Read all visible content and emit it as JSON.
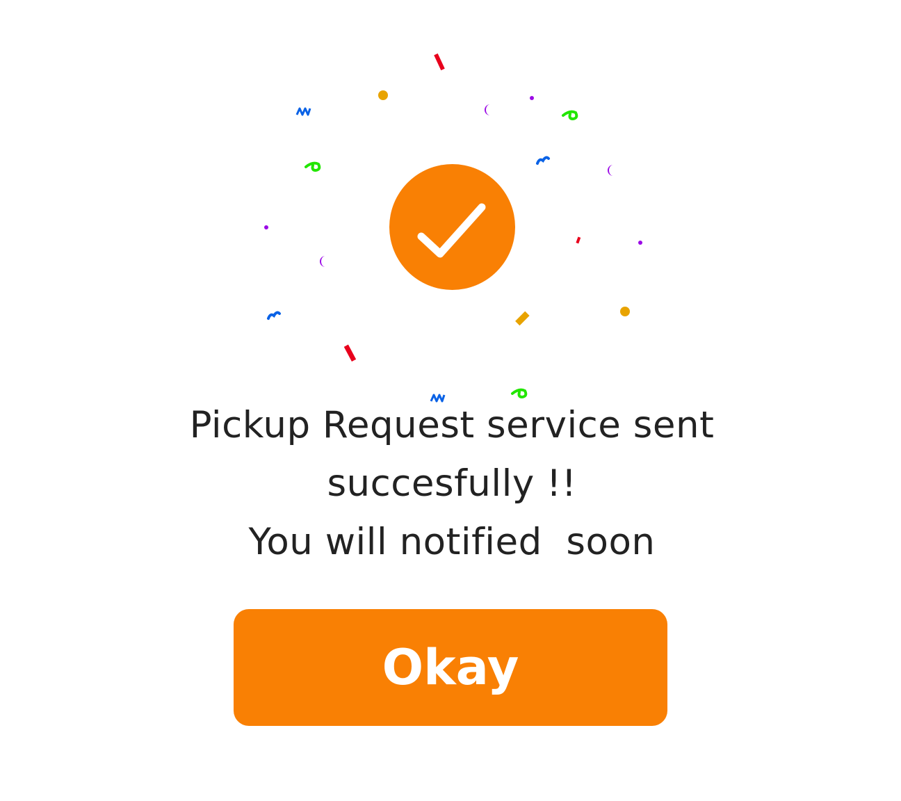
{
  "success": {
    "icon": "check-icon",
    "badge_color": "#F98004"
  },
  "message": {
    "line1": "Pickup Request service sent",
    "line2": "succesfully !!",
    "line3": "You will notified  soon"
  },
  "actions": {
    "okay_label": "Okay",
    "button_color": "#F98004"
  },
  "confetti_colors": [
    "#E8001C",
    "#E8A300",
    "#0A62E6",
    "#22E600",
    "#9B0AE6"
  ]
}
